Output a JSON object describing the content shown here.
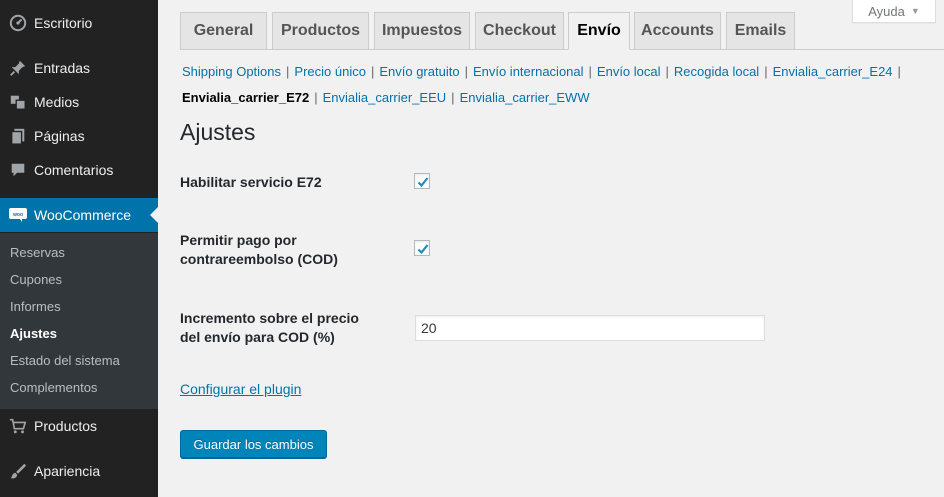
{
  "sidebar": {
    "items": [
      {
        "label": "Escritorio",
        "icon": "dashboard-icon"
      },
      {
        "label": "Entradas",
        "icon": "pin-icon"
      },
      {
        "label": "Medios",
        "icon": "media-icon"
      },
      {
        "label": "Páginas",
        "icon": "pages-icon"
      },
      {
        "label": "Comentarios",
        "icon": "comment-icon"
      },
      {
        "label": "WooCommerce",
        "icon": "woocommerce-icon"
      },
      {
        "label": "Productos",
        "icon": "cart-icon"
      },
      {
        "label": "Apariencia",
        "icon": "brush-icon"
      }
    ],
    "submenu": [
      "Reservas",
      "Cupones",
      "Informes",
      "Ajustes",
      "Estado del sistema",
      "Complementos"
    ]
  },
  "help": {
    "label": "Ayuda"
  },
  "tabs": [
    "General",
    "Productos",
    "Impuestos",
    "Checkout",
    "Envío",
    "Accounts",
    "Emails"
  ],
  "sublinks": {
    "row1": [
      "Shipping Options",
      "Precio único",
      "Envío gratuito",
      "Envío internacional",
      "Envío local",
      "Recogida local",
      "Envialia_carrier_E24"
    ],
    "current": "Envialia_carrier_E72",
    "row2": [
      "Envialia_carrier_EEU",
      "Envialia_carrier_EWW"
    ]
  },
  "section_title": "Ajustes",
  "fields": {
    "enable_label": "Habilitar servicio E72",
    "cod_label_1": "Permitir pago por",
    "cod_label_2": "contrareembolso (COD)",
    "increment_label_1": "Incremento sobre el precio",
    "increment_label_2": "del envío para COD (%)",
    "increment_value": "20"
  },
  "config_link": "Configurar el plugin",
  "save_label": "Guardar los cambios",
  "colors": {
    "accent": "#0073aa",
    "button": "#0085ba",
    "sidebar": "#222222"
  }
}
